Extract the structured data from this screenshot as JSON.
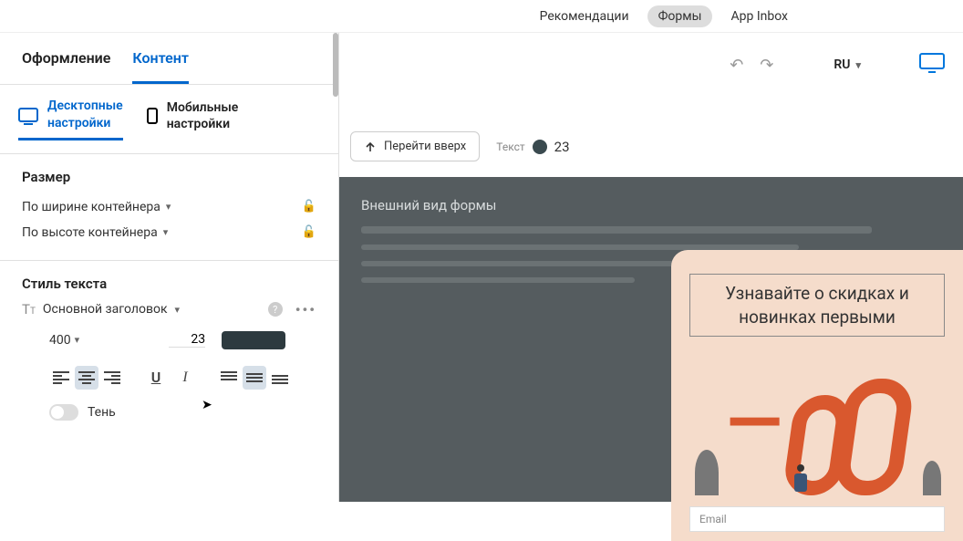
{
  "top_nav": {
    "recommendations": "Рекомендации",
    "forms": "Формы",
    "app_inbox": "App Inbox"
  },
  "sidebar_tabs": {
    "design": "Оформление",
    "content": "Контент"
  },
  "device_tabs": {
    "desktop": "Десктопные\nнастройки",
    "mobile": "Мобильные\nнастройки"
  },
  "size": {
    "title": "Размер",
    "width_mode": "По ширине контейнера",
    "height_mode": "По высоте контейнера"
  },
  "text_style": {
    "title": "Стиль текста",
    "preset": "Основной заголовок",
    "weight": "400",
    "size": "23",
    "color": "#2d3a3f",
    "shadow_label": "Тень"
  },
  "canvas": {
    "lang": "RU",
    "go_up": "Перейти вверх",
    "crumb_label": "Текст",
    "crumb_value": "23",
    "panel_title": "Внешний вид формы"
  },
  "form_preview": {
    "heading": "Узнавайте о скидках и новинках первыми",
    "email_placeholder": "Email"
  }
}
